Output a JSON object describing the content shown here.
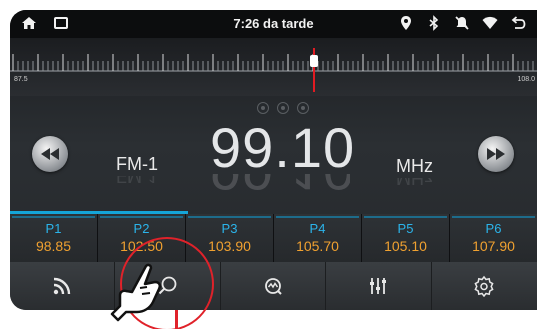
{
  "status_bar": {
    "time": "7:26 da tarde",
    "icons_left": [
      "home-icon",
      "recent-apps-icon"
    ],
    "icons_right": [
      "location-icon",
      "bluetooth-icon",
      "mute-icon",
      "wifi-icon",
      "back-icon"
    ]
  },
  "scale": {
    "min_label": "87.5",
    "max_label": "108.0"
  },
  "tuner": {
    "band": "FM-1",
    "frequency": "99.10",
    "unit": "MHz",
    "mini_indicators": 3
  },
  "presets": [
    {
      "name": "P1",
      "freq": "98.85"
    },
    {
      "name": "P2",
      "freq": "102.50"
    },
    {
      "name": "P3",
      "freq": "103.90"
    },
    {
      "name": "P4",
      "freq": "105.70"
    },
    {
      "name": "P5",
      "freq": "105.10"
    },
    {
      "name": "P6",
      "freq": "107.90"
    }
  ],
  "toolbar": {
    "items": [
      "radio-signal-icon",
      "search-icon",
      "scan-icon",
      "equalizer-icon",
      "settings-icon"
    ]
  },
  "colors": {
    "preset_name": "#2bb4ea",
    "preset_freq": "#f0a130",
    "needle": "#e11b22",
    "highlight": "#e0222a"
  }
}
